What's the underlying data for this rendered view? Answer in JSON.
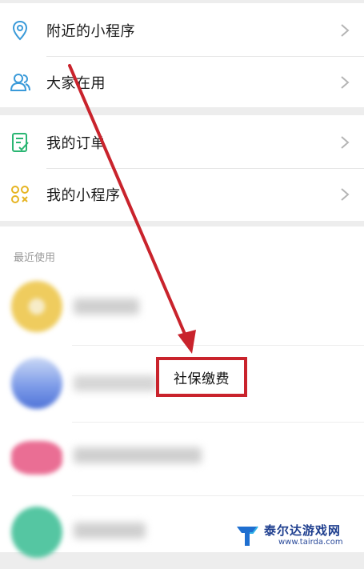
{
  "menu": {
    "group1": [
      {
        "label": "附近的小程序",
        "icon": "location-pin-icon"
      },
      {
        "label": "大家在用",
        "icon": "people-icon"
      }
    ],
    "group2": [
      {
        "label": "我的订单",
        "icon": "order-checklist-icon"
      },
      {
        "label": "我的小程序",
        "icon": "mini-program-icon"
      }
    ]
  },
  "recent": {
    "title": "最近使用",
    "highlighted_label": "社保缴费"
  },
  "watermark": {
    "name": "泰尔达游戏网",
    "url": "www.tairda.com"
  },
  "colors": {
    "accent_green": "#07c160",
    "annotation_red": "#c9232c"
  }
}
